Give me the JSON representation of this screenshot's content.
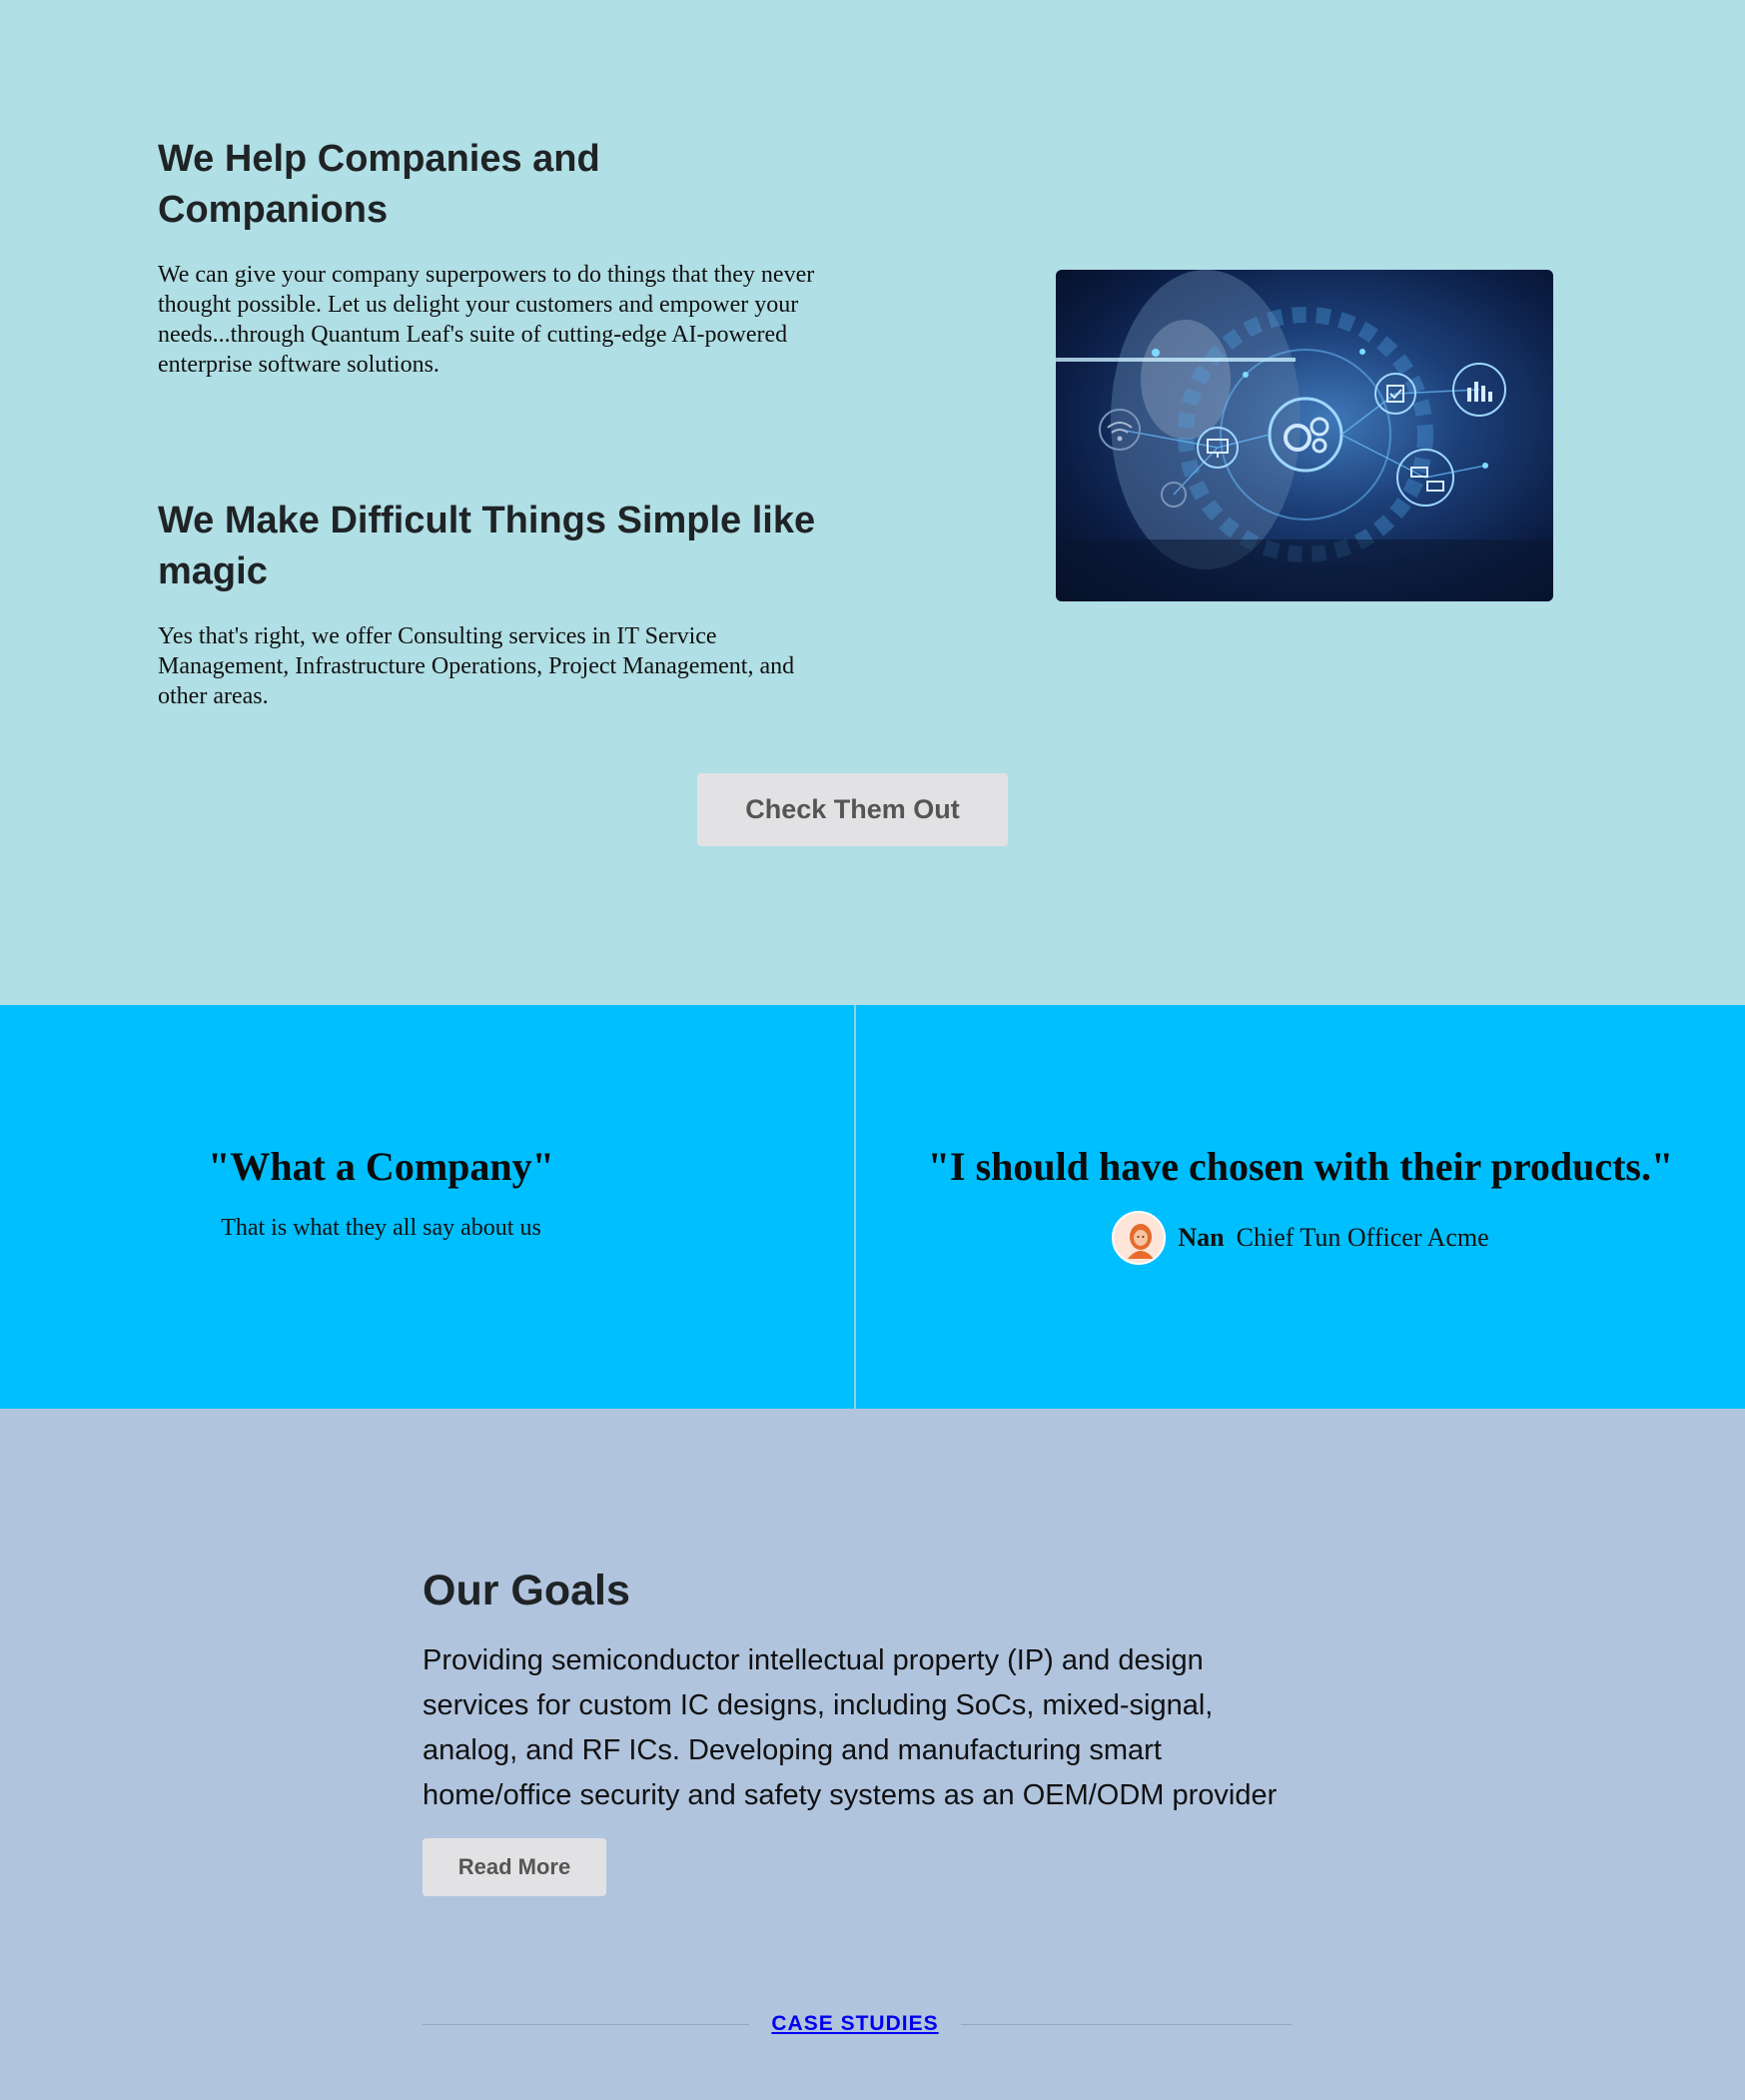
{
  "hero": {
    "heading1": "We Help Companies and Companions",
    "paragraph1": "We can give your company superpowers to do things that they never thought possible. Let us delight your customers and empower your needs...through Quantum Leaf's suite of cutting-edge AI-powered enterprise software solutions.",
    "heading2": "We Make Difficult Things Simple like magic",
    "paragraph2": "Yes that's right, we offer Consulting services in IT Service Management, Infrastructure Operations, Project Management, and other areas.",
    "image_icon": "tech-network-illustration-icon",
    "button_label": "Check Them Out"
  },
  "testimonials": {
    "left_quote": "\"What a Company\"",
    "left_sub": "That is what they all say about us",
    "right_quote": "\"I should have chosen with their products.\"",
    "author_name": "Nan",
    "author_title": "Chief Tun Officer Acme",
    "avatar_icon": "person-avatar-icon"
  },
  "goals": {
    "title": "Our Goals",
    "text": "Providing semiconductor intellectual property (IP) and design services for custom IC designs, including SoCs, mixed-signal, analog, and RF ICs. Developing and manufacturing smart home/office security and safety systems as an OEM/ODM provider",
    "read_more_label": "Read More",
    "case_studies_label": "CASE STUDIES"
  },
  "colors": {
    "hero_bg": "#b0dfe5",
    "testimonials_bg": "#00bfff",
    "goals_bg": "#b0c4de",
    "button_bg": "#e2e2e4",
    "link": "#0000ee"
  }
}
